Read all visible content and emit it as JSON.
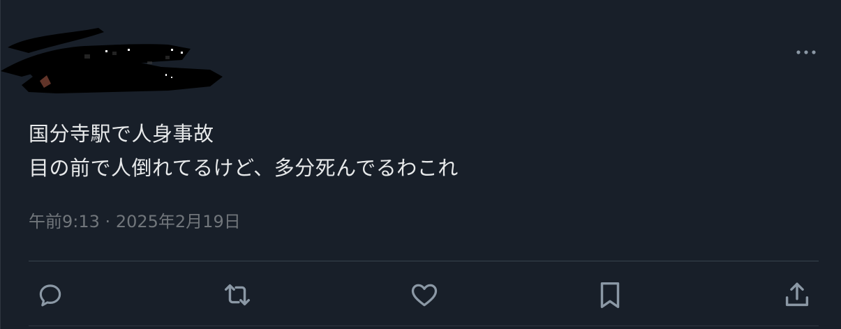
{
  "tweet": {
    "text_lines": [
      "国分寺駅で人身事故",
      "目の前で人倒れてるけど、多分死んでるわこれ"
    ],
    "time": "午前9:13",
    "separator": "·",
    "date": "2025年2月19日"
  },
  "icons": {
    "more": "more-horizontal-icon",
    "reply": "reply-icon",
    "retweet": "retweet-icon",
    "like": "heart-icon",
    "bookmark": "bookmark-icon",
    "share": "share-icon"
  },
  "colors": {
    "background": "#181f29",
    "text": "#e7e9ea",
    "secondary": "#71767b",
    "icon": "#8b98a5"
  }
}
